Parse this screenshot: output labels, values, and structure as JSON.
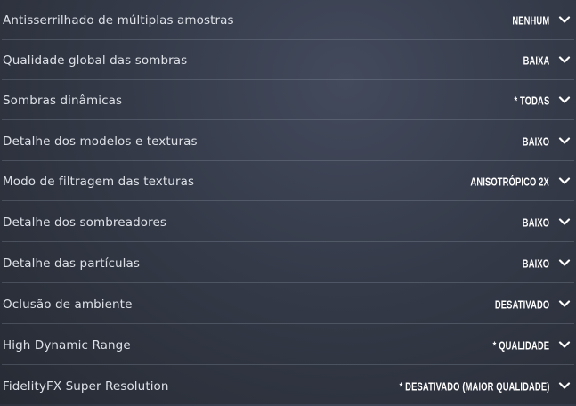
{
  "settings": [
    {
      "label": "Antisserrilhado de múltiplas amostras",
      "value": "NENHUM"
    },
    {
      "label": "Qualidade global das sombras",
      "value": "BAIXA"
    },
    {
      "label": "Sombras dinâmicas",
      "value": "* TODAS"
    },
    {
      "label": "Detalhe dos modelos e texturas",
      "value": "BAIXO"
    },
    {
      "label": "Modo de filtragem das texturas",
      "value": "ANISOTRÓPICO 2X"
    },
    {
      "label": "Detalhe dos sombreadores",
      "value": "BAIXO"
    },
    {
      "label": "Detalhe das partículas",
      "value": "BAIXO"
    },
    {
      "label": "Oclusão de ambiente",
      "value": "DESATIVADO"
    },
    {
      "label": "High Dynamic Range",
      "value": "* QUALIDADE"
    },
    {
      "label": "FidelityFX Super Resolution",
      "value": "* DESATIVADO (MAIOR QUALIDADE)"
    }
  ],
  "icons": {
    "dropdown_indicator": "chevron-down-icon"
  }
}
